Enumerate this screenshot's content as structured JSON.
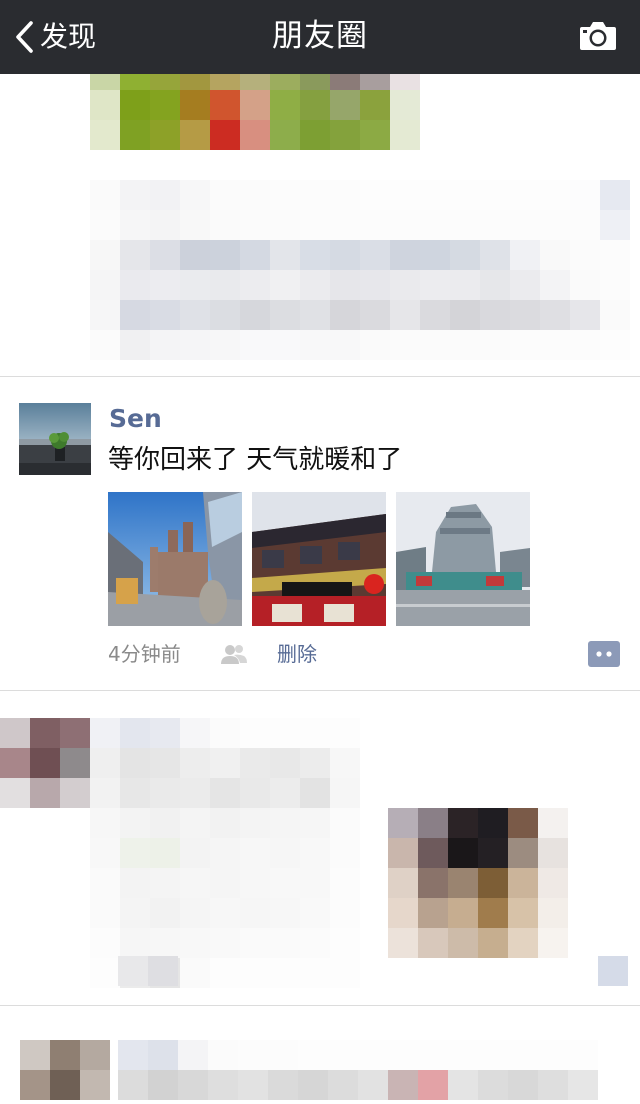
{
  "navbar": {
    "back_label": "发现",
    "title": "朋友圈",
    "back_icon": "chevron-left-icon",
    "camera_icon": "camera-icon"
  },
  "post": {
    "author": "Sen",
    "text": "等你回来了 天气就暖和了",
    "time": "4分钟前",
    "delete_label": "删除",
    "privacy_icon": "people-icon",
    "comment_icon": "comment-icon"
  },
  "colors": {
    "navbar_bg": "#2a2c30",
    "link": "#576b95",
    "divider": "#dcdcdc"
  }
}
